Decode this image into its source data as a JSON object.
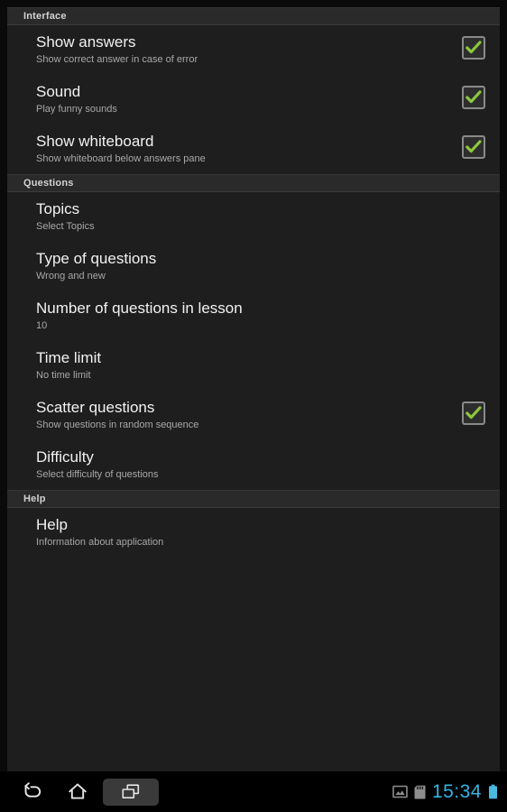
{
  "app": {
    "background_color": "#1e1e1e",
    "accent_color": "#8cc63f",
    "clock_color": "#33b5e5"
  },
  "sections": [
    {
      "header": "Interface",
      "items": [
        {
          "title": "Show answers",
          "summary": "Show correct answer in case of error",
          "widget": "checkbox",
          "checked": true
        },
        {
          "title": "Sound",
          "summary": "Play funny sounds",
          "widget": "checkbox",
          "checked": true
        },
        {
          "title": "Show whiteboard",
          "summary": "Show whiteboard below answers pane",
          "widget": "checkbox",
          "checked": true
        }
      ]
    },
    {
      "header": "Questions",
      "items": [
        {
          "title": "Topics",
          "summary": "Select Topics",
          "widget": "none",
          "checked": false
        },
        {
          "title": "Type of questions",
          "summary": "Wrong and new",
          "widget": "none",
          "checked": false
        },
        {
          "title": "Number of questions in lesson",
          "summary": "10",
          "widget": "none",
          "checked": false
        },
        {
          "title": "Time limit",
          "summary": "No time limit",
          "widget": "none",
          "checked": false
        },
        {
          "title": "Scatter questions",
          "summary": "Show questions in random sequence",
          "widget": "checkbox",
          "checked": true
        },
        {
          "title": "Difficulty",
          "summary": "Select difficulty of questions",
          "widget": "none",
          "checked": false
        }
      ]
    },
    {
      "header": "Help",
      "items": [
        {
          "title": "Help",
          "summary": "Information about application",
          "widget": "none",
          "checked": false
        }
      ]
    }
  ],
  "system_bar": {
    "nav": [
      {
        "icon": "back-icon",
        "label": "Back"
      },
      {
        "icon": "home-icon",
        "label": "Home"
      },
      {
        "icon": "recents-icon",
        "label": "Recent apps"
      }
    ],
    "status": {
      "icons": [
        {
          "icon": "screenshot-image-icon",
          "label": "Screenshot captured"
        },
        {
          "icon": "sd-card-icon",
          "label": "SD card"
        }
      ],
      "clock": "15:34",
      "battery": {
        "icon": "battery-icon",
        "label": "Battery"
      }
    }
  }
}
